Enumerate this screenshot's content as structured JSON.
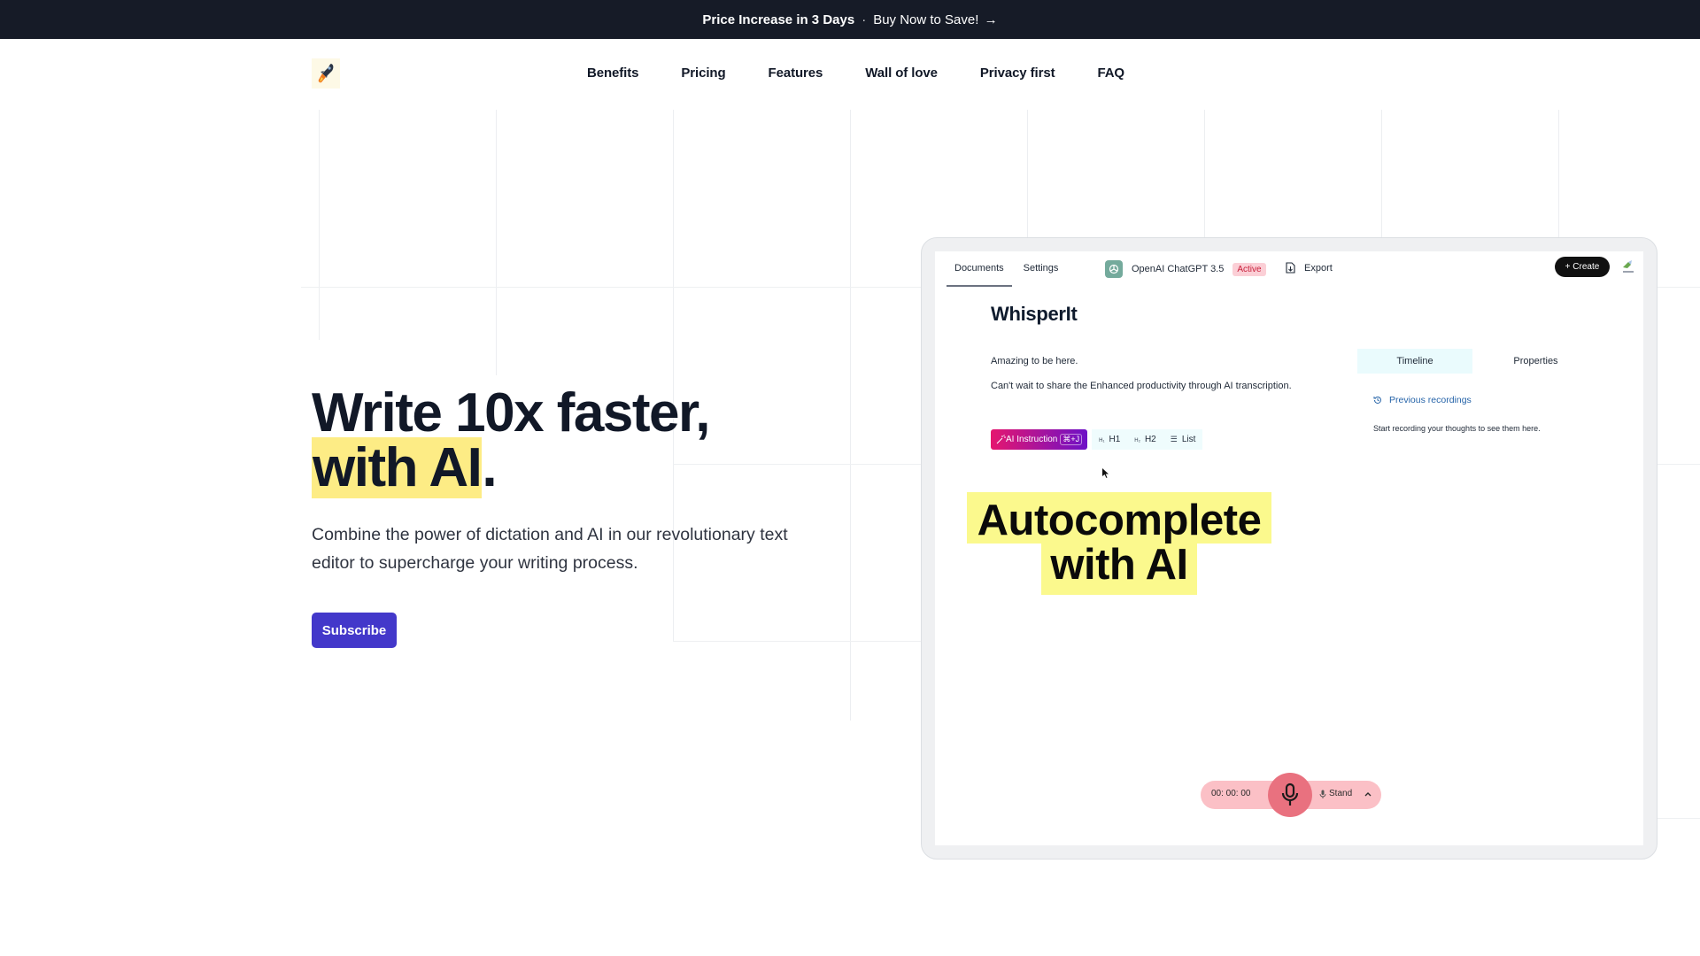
{
  "announcement": {
    "headline": "Price Increase in 3 Days",
    "separator": "·",
    "cta": "Buy Now to Save!",
    "arrow": "→"
  },
  "nav": {
    "logo_icon": "rocket-icon",
    "links": [
      "Benefits",
      "Pricing",
      "Features",
      "Wall of love",
      "Privacy first",
      "FAQ"
    ]
  },
  "hero": {
    "title_line1": "Write 10x faster,",
    "title_highlight": "with AI",
    "title_end": ".",
    "subtitle": "Combine the power of dictation and AI in our revolutionary text editor to supercharge your writing process.",
    "cta": "Subscribe"
  },
  "app": {
    "tabs": [
      "Documents",
      "Settings"
    ],
    "active_tab": "Documents",
    "model": {
      "name": "OpenAI ChatGPT 3.5",
      "status": "Active",
      "icon": "openai-icon"
    },
    "export_label": "Export",
    "create_label": "+ Create",
    "document": {
      "title": "WhisperIt",
      "paragraphs": [
        "Amazing to be here.",
        "Can't wait to share the Enhanced productivity through AI transcription."
      ]
    },
    "toolbar": {
      "ai_label": "AI Instruction",
      "ai_shortcut": "⌘+J",
      "h1_label": "H1",
      "h2_label": "H2",
      "list_label": "List"
    },
    "side_panel": {
      "tabs": [
        "Timeline",
        "Properties"
      ],
      "active_tab": "Timeline",
      "previous_label": "Previous recordings",
      "empty_hint": "Start recording your thoughts to see them here."
    },
    "overlay": {
      "line1": "Autocomplete",
      "line2": "with AI"
    },
    "recorder": {
      "timer": "00: 00: 00",
      "mode": "Stand"
    }
  },
  "colors": {
    "announcement_bg": "#161b27",
    "primary": "#4338ca",
    "highlight": "#fdec85",
    "overlay_highlight": "#fbf98d",
    "recorder_bg": "#fbc0c6",
    "mic_bg": "#e9717f",
    "badge_bg": "#fbcfd6"
  }
}
